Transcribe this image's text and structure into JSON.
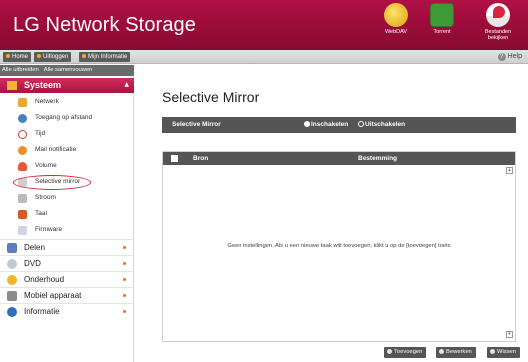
{
  "header": {
    "title": "LG Network Storage",
    "buttons": [
      {
        "label": "WebDAV",
        "icon": "webdav-icon"
      },
      {
        "label": "Torrent",
        "icon": "torrent-icon"
      },
      {
        "label": "Bestanden bekijken",
        "icon": "files-icon"
      }
    ]
  },
  "toolbar": {
    "links": [
      "Home",
      "Uitloggen",
      "Mijn Informatie"
    ],
    "help": "Help"
  },
  "sidebar": {
    "expand_all": "Alle uitbreiden",
    "collapse_all": "Alle samenvouwen",
    "active_section": "Systeem",
    "sub_items": [
      "Netwerk",
      "Toegang op afstand",
      "Tijd",
      "Mail notificatie",
      "Volume",
      "Selective mirror",
      "Stroom",
      "Taal",
      "Firmware"
    ],
    "sections": [
      "Delen",
      "DVD",
      "Onderhoud",
      "Mobiel apparaat",
      "Informatie"
    ]
  },
  "main": {
    "title": "Selective Mirror",
    "setting_label": "Selective Mirror",
    "radio_on": "Inschakelen",
    "radio_off": "Uitschakelen",
    "selected": "Inschakelen",
    "columns": [
      "Bron",
      "Bestemming"
    ],
    "empty_message": "Geen instellingen. Als u een nieuwe taak wilt toevoegen, klikt u op de [toevoegen] toets",
    "actions": [
      "Toevoegen",
      "Bewerken",
      "Wissen"
    ]
  },
  "colors": {
    "header": "#9c0c3a",
    "active_section": "#c21f4e",
    "bar": "#555555",
    "highlight_oval": "#d9232e"
  }
}
